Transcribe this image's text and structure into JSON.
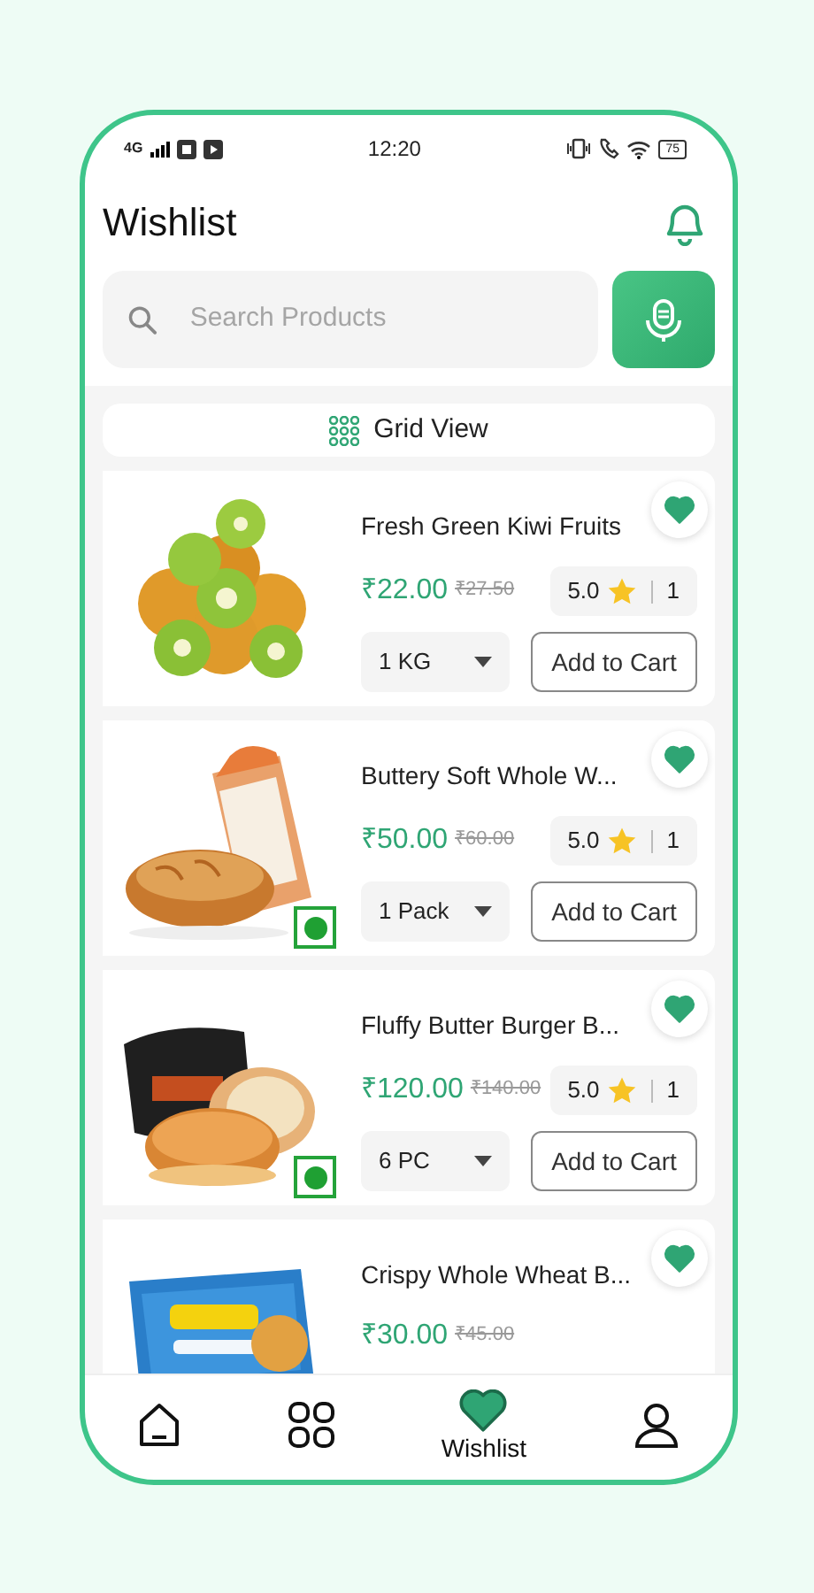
{
  "status_bar": {
    "time": "12:20",
    "network": "4G",
    "battery": "75"
  },
  "header": {
    "title": "Wishlist"
  },
  "search": {
    "placeholder": "Search Products"
  },
  "view_toggle": {
    "label": "Grid View"
  },
  "products": [
    {
      "name": "Fresh Green Kiwi Fruits",
      "price": "₹22.00",
      "old_price": "₹27.50",
      "rating": "5.0",
      "rating_count": "1",
      "unit": "1 KG",
      "cart_label": "Add to Cart",
      "wishlisted": true,
      "veg": false
    },
    {
      "name": "Buttery Soft Whole W...",
      "price": "₹50.00",
      "old_price": "₹60.00",
      "rating": "5.0",
      "rating_count": "1",
      "unit": "1 Pack",
      "cart_label": "Add to Cart",
      "wishlisted": true,
      "veg": true
    },
    {
      "name": "Fluffy Butter Burger B...",
      "price": "₹120.00",
      "old_price": "₹140.00",
      "rating": "5.0",
      "rating_count": "1",
      "unit": "6 PC",
      "cart_label": "Add to Cart",
      "wishlisted": true,
      "veg": true
    },
    {
      "name": "Crispy Whole Wheat B...",
      "price": "₹30.00",
      "old_price": "₹45.00",
      "wishlisted": true,
      "veg": false
    }
  ],
  "bottom_nav": [
    {
      "selected": false
    },
    {
      "selected": false
    },
    {
      "label": "Wishlist",
      "selected": true
    },
    {
      "selected": false
    }
  ]
}
